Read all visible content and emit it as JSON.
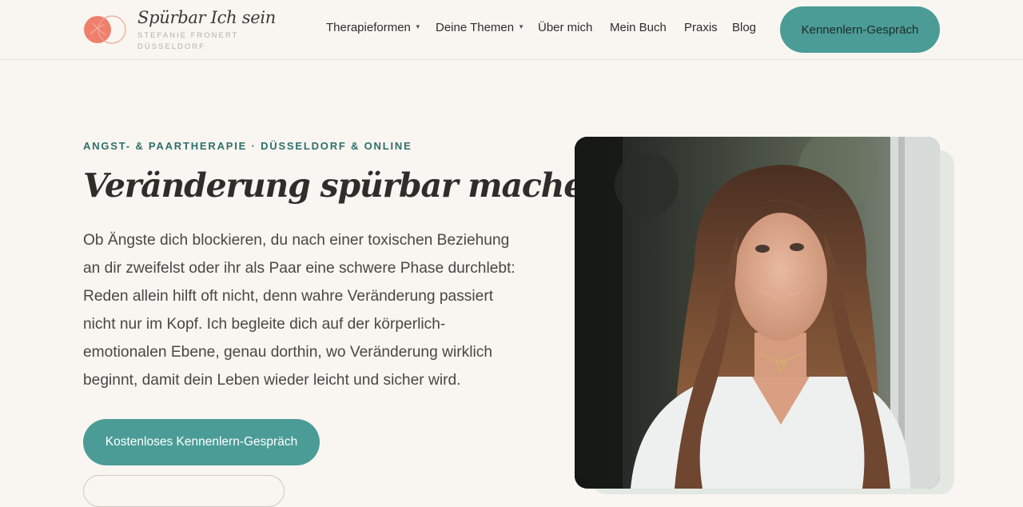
{
  "brand": {
    "title": "Spürbar Ich sein",
    "subtitle_line1": "STEFANIE FRONERT",
    "subtitle_line2": "DÜSSELDORF",
    "colors": {
      "accent": "#4b9c96",
      "logo_coral": "#ef7f6d",
      "teal_text": "#2f6f6b"
    }
  },
  "nav": {
    "items": [
      {
        "label": "Therapieformen",
        "has_dropdown": true
      },
      {
        "label": "Deine Themen",
        "has_dropdown": true
      },
      {
        "label": "Über mich",
        "has_dropdown": false
      },
      {
        "label": "Mein Buch",
        "has_dropdown": false
      },
      {
        "label": "Praxis",
        "has_dropdown": false
      },
      {
        "label": "Blog",
        "has_dropdown": false
      }
    ],
    "cta_label": "Kennenlern-Gespräch"
  },
  "hero": {
    "eyebrow": "ANGST- & PAARTHERAPIE · DÜSSELDORF & ONLINE",
    "headline": "Veränderung spürbar machen.",
    "lead_lines": [
      "Ob Ängste dich blockieren, du nach einer toxischen Beziehung",
      "an dir zweifelst oder ihr als Paar eine schwere Phase durchlebt:",
      "Reden allein hilft oft nicht, denn wahre Veränderung passiert",
      "nicht nur im Kopf. Ich begleite dich auf der körperlich-",
      "emotionalen Ebene, genau dorthin, wo Veränderung wirklich",
      "beginnt, damit dein Leben wieder leicht und sicher wird."
    ],
    "cta_label": "Kostenloses Kennenlern-Gespräch"
  },
  "icons": {
    "logo": "overlapping-circles-logo",
    "dropdown": "caret-down-icon"
  }
}
